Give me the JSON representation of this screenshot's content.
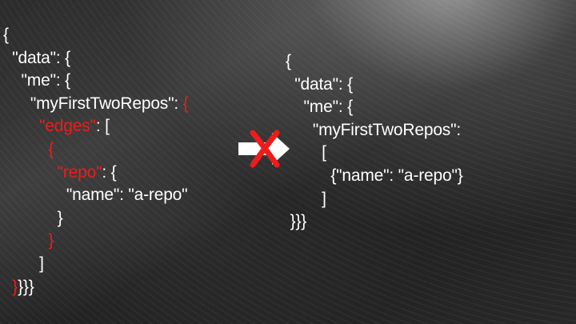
{
  "left_json": {
    "lines": [
      {
        "indent": "",
        "pre": "{",
        "red": "",
        "post": ""
      },
      {
        "indent": "  ",
        "pre": "\"data\": {",
        "red": "",
        "post": ""
      },
      {
        "indent": "    ",
        "pre": "\"me\": {",
        "red": "",
        "post": ""
      },
      {
        "indent": "      ",
        "pre": "\"myFirstTwoRepos\": ",
        "red": "{",
        "post": ""
      },
      {
        "indent": "        ",
        "pre": "",
        "red": "\"edges\"",
        "post": ": ["
      },
      {
        "indent": "          ",
        "pre": "",
        "red": "{",
        "post": ""
      },
      {
        "indent": "            ",
        "pre": "",
        "red": "\"repo\"",
        "post": ": {"
      },
      {
        "indent": "              ",
        "pre": "\"name\": \"a-repo\"",
        "red": "",
        "post": ""
      },
      {
        "indent": "            ",
        "pre": "}",
        "red": "",
        "post": ""
      },
      {
        "indent": "          ",
        "pre": "",
        "red": "}",
        "post": ""
      },
      {
        "indent": "        ",
        "pre": "]",
        "red": "",
        "post": ""
      },
      {
        "indent": "  ",
        "pre": "",
        "red": "}",
        "post": "}}}"
      }
    ]
  },
  "right_json": {
    "lines": [
      {
        "indent": "",
        "text": "{"
      },
      {
        "indent": "  ",
        "text": "\"data\": {"
      },
      {
        "indent": "    ",
        "text": "\"me\": {"
      },
      {
        "indent": "      ",
        "text": "\"myFirstTwoRepos\":"
      },
      {
        "indent": "        ",
        "text": "["
      },
      {
        "indent": "          ",
        "text": "{\"name\": \"a-repo\"}"
      },
      {
        "indent": "        ",
        "text": "]"
      },
      {
        "indent": " ",
        "text": "}}}"
      }
    ]
  },
  "icons": {
    "arrow": "right-arrow-icon",
    "cross": "red-x-icon"
  },
  "colors": {
    "text": "#ffffff",
    "highlight": "#ee1c1c",
    "background": "#2b2b2b"
  }
}
